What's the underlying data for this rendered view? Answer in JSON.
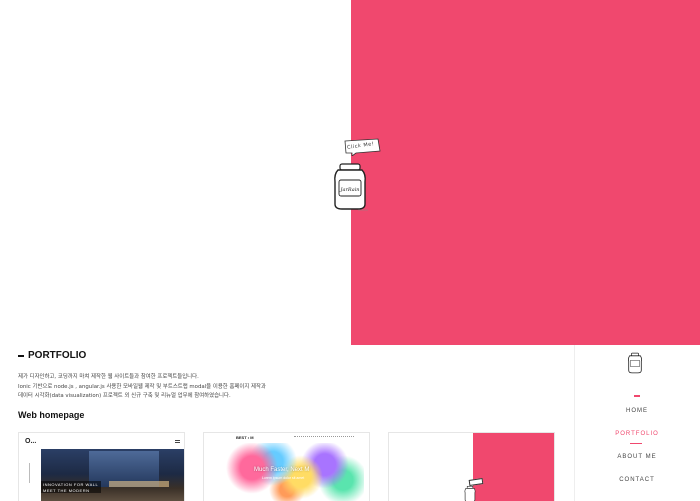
{
  "hero": {
    "bubble_text": "Click Me!",
    "jar_label": "JarOfRain",
    "accent_color": "#f0486e"
  },
  "portfolio": {
    "title": "PORTFOLIO",
    "description_lines": [
      "제가 디자인하고, 코딩까지 마쳐 제작한 웹 사이트들과 참여한 프로젝트들입니다.",
      "Ionic 기반으로 node.js , angular.js 사용한 모바일웹 제작 및 부트스트랩 modal을 이용한 홈페이지 제작과",
      "데이터 시각화(data visualization) 프로젝트 외 신규 구축 및 리뉴얼 업무에 참여하였습니다."
    ],
    "subsection": "Web homepage",
    "thumbs": [
      {
        "logo": "O...",
        "caption_1": "INNOVATION FOR WALL",
        "caption_2": "MEET THE MODERN"
      },
      {
        "logo": "BEST • M",
        "headline": "Much Faster, Next M",
        "sub": "Lorem ipsum dolor sit amet"
      },
      {
        "label": "Click Me!"
      }
    ]
  },
  "nav": {
    "items": [
      "HOME",
      "PORTFOLIO",
      "ABOUT ME",
      "CONTACT"
    ],
    "active": "PORTFOLIO"
  }
}
